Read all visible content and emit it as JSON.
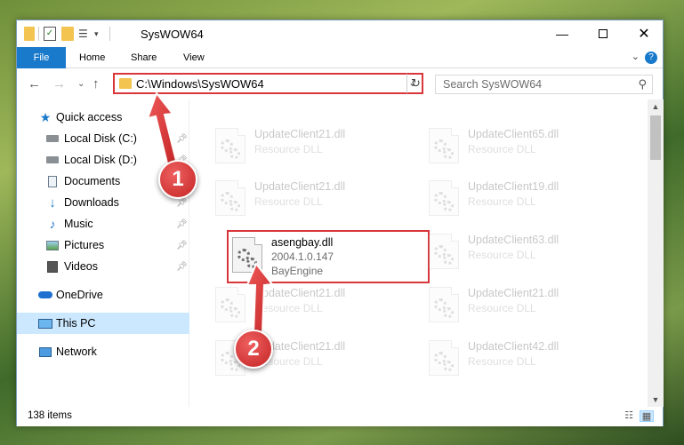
{
  "window": {
    "title": "SysWOW64",
    "minimize_icon": "minimize-icon",
    "maximize_icon": "maximize-icon",
    "close_icon": "close-icon"
  },
  "ribbon": {
    "tabs": [
      "File",
      "Home",
      "Share",
      "View"
    ],
    "active_tab": "File",
    "expand_icon": "chevron-down-icon",
    "help_label": "?"
  },
  "navigation": {
    "address_path": "C:\\Windows\\SysWOW64",
    "search_placeholder": "Search SysWOW64"
  },
  "sidebar": {
    "items": [
      {
        "label": "Quick access",
        "icon": "star-icon"
      },
      {
        "label": "Local Disk (C:)",
        "icon": "drive-icon",
        "pinned": true
      },
      {
        "label": "Local Disk (D:)",
        "icon": "drive-icon",
        "pinned": true
      },
      {
        "label": "Documents",
        "icon": "documents-icon",
        "pinned": true
      },
      {
        "label": "Downloads",
        "icon": "downloads-icon",
        "pinned": true
      },
      {
        "label": "Music",
        "icon": "music-icon",
        "pinned": true
      },
      {
        "label": "Pictures",
        "icon": "pictures-icon",
        "pinned": true
      },
      {
        "label": "Videos",
        "icon": "videos-icon",
        "pinned": true
      },
      {
        "label": "OneDrive",
        "icon": "cloud-icon"
      },
      {
        "label": "This PC",
        "icon": "computer-icon",
        "selected": true
      },
      {
        "label": "Network",
        "icon": "network-icon"
      }
    ]
  },
  "files": [
    {
      "name": "UpdateClient21.dll",
      "type": "Resource DLL"
    },
    {
      "name": "UpdateClient65.dll",
      "type": "Resource DLL"
    },
    {
      "name": "UpdateClient21.dll",
      "type": "Resource DLL"
    },
    {
      "name": "UpdateClient19.dll",
      "type": "Resource DLL"
    },
    {
      "name": "asengbay.dll",
      "version": "2004.1.0.147",
      "company": "BayEngine",
      "highlighted": true
    },
    {
      "name": "UpdateClient63.dll",
      "type": "Resource DLL"
    },
    {
      "name": "UpdateClient21.dll",
      "type": "Resource DLL"
    },
    {
      "name": "UpdateClient21.dll",
      "type": "Resource DLL"
    },
    {
      "name": "UpdateClient21.dll",
      "type": "Resource DLL"
    },
    {
      "name": "UpdateClient42.dll",
      "type": "Resource DLL"
    }
  ],
  "status": {
    "item_count": "138 items"
  },
  "annotations": {
    "step1": "1",
    "step2": "2",
    "color": "#d9363b"
  }
}
